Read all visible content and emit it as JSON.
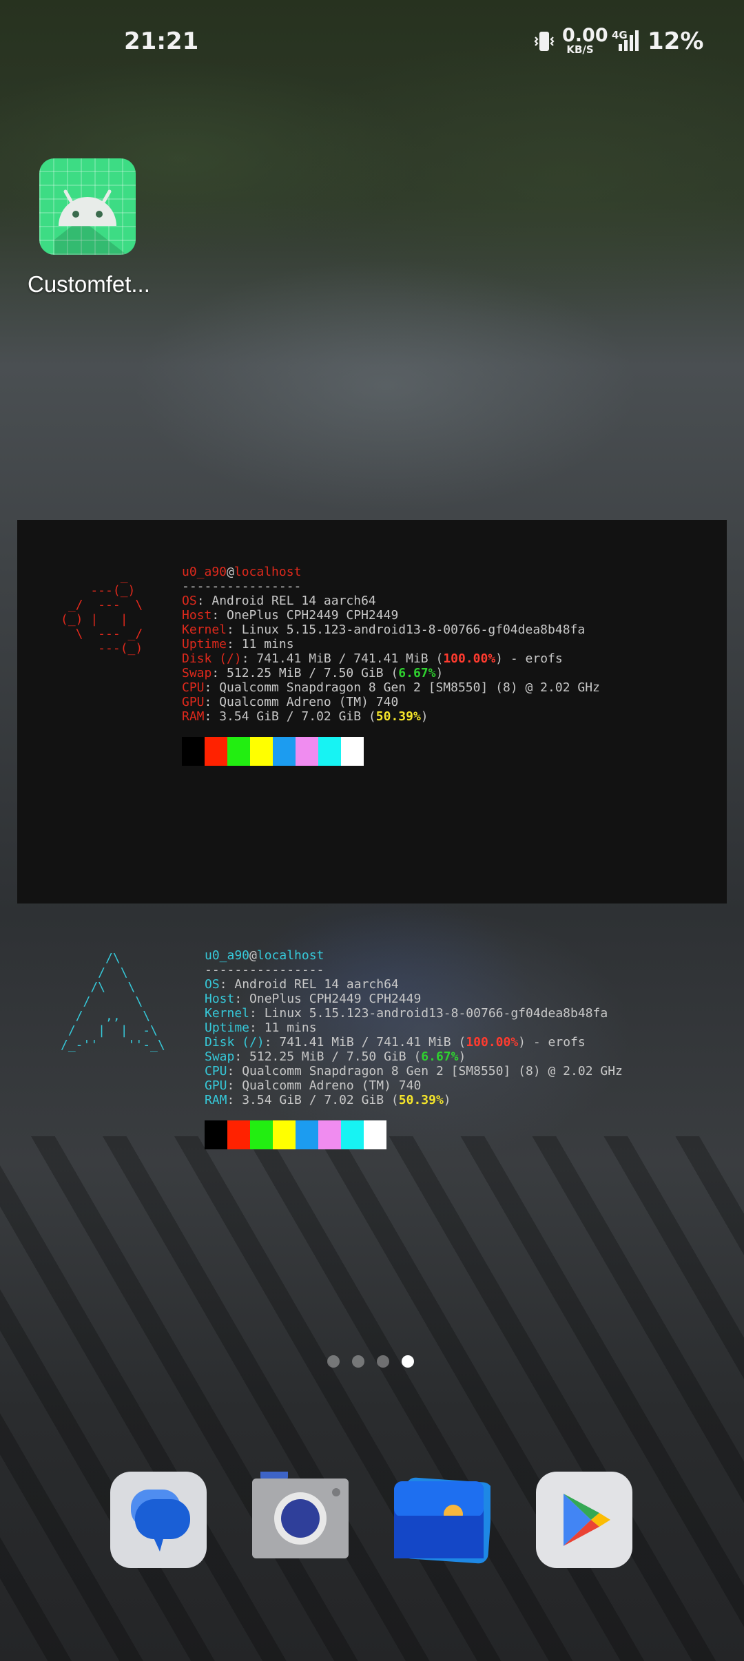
{
  "status_bar": {
    "time": "21:21",
    "net_speed_value": "0.00",
    "net_speed_unit": "KB/S",
    "network_type": "4G",
    "battery": "12%",
    "icons": [
      "vibrate-icon",
      "signal-icon"
    ]
  },
  "home_apps": [
    {
      "label": "Customfet...",
      "icon": "android-robot-icon"
    }
  ],
  "fetch_widgets": [
    {
      "style": "dark",
      "ascii_color": "#e0291c",
      "key_color": "#e0291c",
      "ascii_art": "        _\n    ---(_)\n _/  ---  \\\n(_) |   |\n  \\  --- _/\n     ---(_)",
      "user": "u0_a90",
      "at": "@",
      "host": "localhost",
      "separator": "----------------",
      "lines": [
        {
          "key": "OS",
          "value": ": Android REL 14 aarch64"
        },
        {
          "key": "Host",
          "value": ": OnePlus CPH2449 CPH2449"
        },
        {
          "key": "Kernel",
          "value": ": Linux 5.15.123-android13-8-00766-gf04dea8b48fa"
        },
        {
          "key": "Uptime",
          "value": ": 11 mins"
        },
        {
          "key": "Disk (/)",
          "value": ": 741.41 MiB / 741.41 MiB (",
          "highlight": "100.00%",
          "highlight_color": "#ff3b2f",
          "suffix": ") - erofs"
        },
        {
          "key": "Swap",
          "value": ": 512.25 MiB / 7.50 GiB (",
          "highlight": "6.67%",
          "highlight_color": "#2fd12f",
          "suffix": ")"
        },
        {
          "key": "CPU",
          "value": ": Qualcomm Snapdragon 8 Gen 2 [SM8550] (8) @ 2.02 GHz"
        },
        {
          "key": "GPU",
          "value": ": Qualcomm Adreno (TM) 740"
        },
        {
          "key": "RAM",
          "value": ": 3.54 GiB / 7.02 GiB (",
          "highlight": "50.39%",
          "highlight_color": "#f5e52a",
          "suffix": ")"
        }
      ]
    },
    {
      "style": "transparent",
      "ascii_color": "#36c9d9",
      "key_color": "#36c9d9",
      "ascii_art": "      /\\\n     /  \\\n    /\\   \\\n   /      \\\n  /   ,,   \\\n /   |  |  -\\\n/_-''    ''-_\\",
      "user": "u0_a90",
      "at": "@",
      "host": "localhost",
      "separator": "----------------",
      "lines": [
        {
          "key": "OS",
          "value": ": Android REL 14 aarch64"
        },
        {
          "key": "Host",
          "value": ": OnePlus CPH2449 CPH2449"
        },
        {
          "key": "Kernel",
          "value": ": Linux 5.15.123-android13-8-00766-gf04dea8b48fa"
        },
        {
          "key": "Uptime",
          "value": ": 11 mins"
        },
        {
          "key": "Disk (/)",
          "value": ": 741.41 MiB / 741.41 MiB (",
          "highlight": "100.00%",
          "highlight_color": "#ff3b2f",
          "suffix": ") - erofs"
        },
        {
          "key": "Swap",
          "value": ": 512.25 MiB / 7.50 GiB (",
          "highlight": "6.67%",
          "highlight_color": "#2fd12f",
          "suffix": ")"
        },
        {
          "key": "CPU",
          "value": ": Qualcomm Snapdragon 8 Gen 2 [SM8550] (8) @ 2.02 GHz"
        },
        {
          "key": "GPU",
          "value": ": Qualcomm Adreno (TM) 740"
        },
        {
          "key": "RAM",
          "value": ": 3.54 GiB / 7.02 GiB (",
          "highlight": "50.39%",
          "highlight_color": "#f5e52a",
          "suffix": ")"
        }
      ]
    }
  ],
  "palette": [
    "#000000",
    "#ff2200",
    "#22ee11",
    "#ffff00",
    "#1c9cf0",
    "#f08cf0",
    "#17f3f3",
    "#ffffff"
  ],
  "page_indicator": {
    "count": 4,
    "active": 3
  },
  "dock": [
    {
      "icon": "messages-icon"
    },
    {
      "icon": "camera-icon"
    },
    {
      "icon": "gallery-icon"
    },
    {
      "icon": "play-store-icon"
    }
  ]
}
